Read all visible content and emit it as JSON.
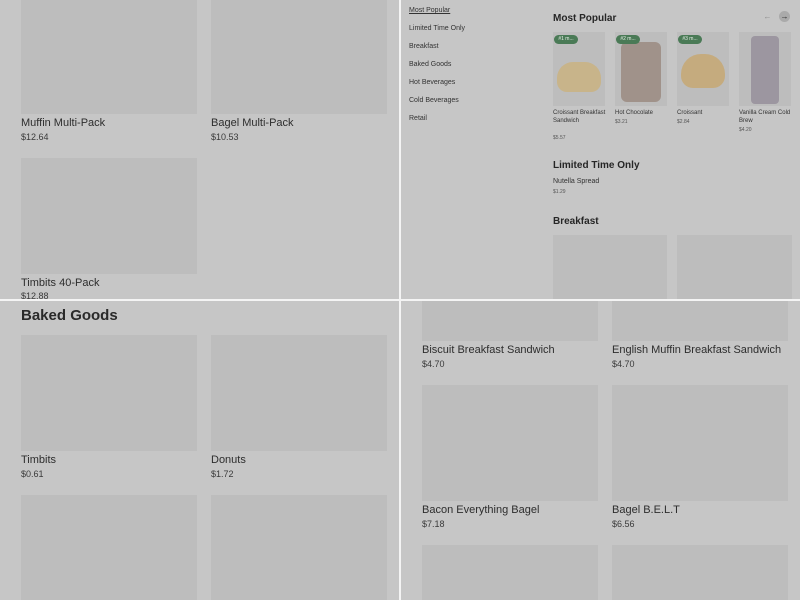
{
  "top_left": {
    "products": [
      {
        "name": "Muffin Multi-Pack",
        "price": "$12.64"
      },
      {
        "name": "Bagel Multi-Pack",
        "price": "$10.53"
      },
      {
        "name": "Timbits 40-Pack",
        "price": "$12.88"
      }
    ]
  },
  "top_right": {
    "categories": [
      "Most Popular",
      "Limited Time Only",
      "Breakfast",
      "Baked Goods",
      "Hot Beverages",
      "Cold Beverages",
      "Retail"
    ],
    "most_popular": {
      "title": "Most Popular",
      "prev_icon": "←",
      "next_icon": "→",
      "items": [
        {
          "badge": "#1 m...",
          "name": "Croissant Breakfast Sandwich",
          "price": "$5.57"
        },
        {
          "badge": "#2 m...",
          "name": "Hot Chocolate",
          "price": "$3.21"
        },
        {
          "badge": "#3 m...",
          "name": "Croissant",
          "price": "$2.84"
        },
        {
          "badge": "",
          "name": "Vanilla Cream Cold Brew",
          "price": "$4.20"
        }
      ]
    },
    "limited": {
      "title": "Limited Time Only",
      "item_name": "Nutella Spread",
      "item_price": "$1.29"
    },
    "breakfast_title": "Breakfast"
  },
  "bottom_left": {
    "section_title": "Baked Goods",
    "products": [
      {
        "name": "Timbits",
        "price": "$0.61"
      },
      {
        "name": "Donuts",
        "price": "$1.72"
      }
    ]
  },
  "bottom_right": {
    "products": [
      {
        "name": "Biscuit Breakfast Sandwich",
        "price": "$4.70"
      },
      {
        "name": "English Muffin Breakfast Sandwich",
        "price": "$4.70"
      },
      {
        "name": "Bacon Everything Bagel",
        "price": "$7.18"
      },
      {
        "name": "Bagel B.E.L.T",
        "price": "$6.56"
      }
    ]
  },
  "colors": {
    "overlay_gray": "#c6c6c6",
    "badge_green": "#4a7a56",
    "divider": "#f4f4f4"
  }
}
